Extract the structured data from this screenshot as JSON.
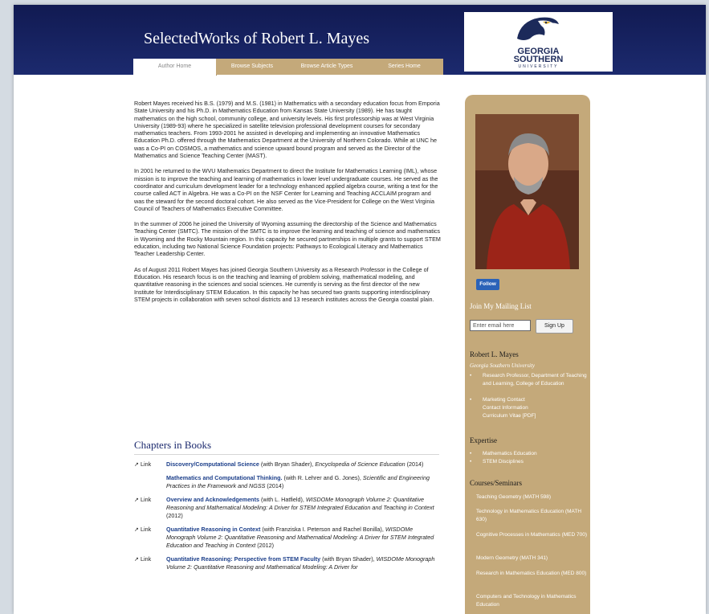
{
  "header": {
    "site_title": "SelectedWorks of Robert L. Mayes",
    "logo": {
      "line1": "GEORGIA",
      "line2": "SOUTHERN",
      "line3": "UNIVERSITY"
    },
    "tabs": [
      "Author Home",
      "Browse Subjects",
      "Browse Article Types",
      "Series Home"
    ]
  },
  "bio": [
    "Robert Mayes received his B.S. (1979) and M.S. (1981) in Mathematics with a secondary education focus from Emporia State University and his Ph.D. in Mathematics Education from Kansas State University (1989). He has taught mathematics on the high school, community college, and university levels. His first professorship was at West Virginia University (1989-93) where he specialized in satellite television professional development courses for secondary mathematics teachers. From 1993-2001 he assisted in developing and implementing an innovative Mathematics Education Ph.D. offered through the Mathematics Department at the University of Northern Colorado. While at UNC he was a Co-PI on COSMOS, a mathematics and science upward bound program and served as the Director of the Mathematics and Science Teaching Center (MAST).",
    "In 2001 he returned to the WVU Mathematics Department to direct the Institute for Mathematics Learning (IML), whose mission is to improve the teaching and learning of mathematics in lower level undergraduate courses. He served as the coordinator and curriculum development leader for a technology enhanced applied algebra course, writing a text for the course called ACT in Algebra. He was a Co-PI on the NSF Center for Learning and Teaching ACCLAIM program and was the steward for the second doctoral cohort. He also served as the Vice-President for College on the West Virginia Council of Teachers of Mathematics Executive Committee.",
    "In the summer of 2006 he joined the University of Wyoming assuming the directorship of the Science and Mathematics Teaching Center (SMTC). The mission of the SMTC is to improve the learning and teaching of science and mathematics in Wyoming and the Rocky Mountain region. In this capacity he secured partnerships in multiple grants to support STEM education, including two National Science Foundation projects: Pathways to Ecological Literacy and Mathematics Teacher Leadership Center.",
    "As of August 2011 Robert Mayes has joined Georgia Southern University as a Research Professor in the College of Education. His research focus is on the teaching and learning of problem solving, mathematical modeling, and quantitative reasoning in the sciences and social sciences. He currently is serving as the first director of the new Institute for Interdisciplinary STEM Education. In this capacity he has secured two grants supporting interdisciplinary STEM projects in collaboration with seven school districts and 13 research institutes across the Georgia coastal plain."
  ],
  "chapters": {
    "heading": "Chapters in Books",
    "link_label": "Link",
    "entries": [
      {
        "link": true,
        "title": "Discovery/Computational Science",
        "authors": " (with Bryan Shader), ",
        "source": "Encyclopedia of Science Education",
        "year": " (2014)"
      },
      {
        "link": false,
        "title": "Mathematics and Computational Thinking.",
        "authors": " (with R. Lehrer and G. Jones), ",
        "source": "Scientific and Engineering Practices in the Framework and NGSS",
        "year": " (2014)"
      },
      {
        "link": true,
        "title": "Overview and Acknowledgements",
        "authors": " (with L. Hatfield), ",
        "source": "WISDOMe Monograph Volume 2: Quantitative Reasoning and Mathematical Modeling: A Driver for STEM Integrated Education and Teaching in Context",
        "year": " (2012)"
      },
      {
        "link": true,
        "title": "Quantitative Reasoning in Context",
        "authors": " (with Franziska I. Peterson and Rachel Bonilla), ",
        "source": "WISDOMe Monograph Volume 2: Quantitative Reasoning and Mathematical Modeling: A Driver for STEM Integrated Education and Teaching in Context",
        "year": " (2012)"
      },
      {
        "link": true,
        "title": "Quantitative Reasoning: Perspective from STEM Faculty",
        "authors": " (with Bryan Shader), ",
        "source": "WISDOMe Monograph Volume 2: Quantitative Reasoning and Mathematical Modeling: A Driver for",
        "year": ""
      }
    ]
  },
  "sidebar": {
    "follow_label": "Follow",
    "mailing_heading": "Join My Mailing List",
    "email_placeholder": "Enter email here",
    "signup_label": "Sign Up",
    "name": "Robert L. Mayes",
    "institution": "Georgia Southern University",
    "profile_items": [
      "Research Professor, Department of Teaching and Learning, College of Education",
      "Marketing Contact",
      "Contact Information",
      "Curriculum Vitae [PDF]"
    ],
    "expertise_heading": "Expertise",
    "expertise": [
      "Mathematics Education",
      "STEM Disciplines"
    ],
    "courses_heading": "Courses/Seminars",
    "courses": [
      "Teaching Geometry (MATH 598)",
      "Technology in Mathematics Education (MATH 630)",
      "Cognitive Processes in Mathematics (MED 700)",
      "Modern Geometry (MATH 341)",
      "Research in Mathematics Education (MED 800)",
      "Computers and Technology in Mathematics Education"
    ]
  }
}
